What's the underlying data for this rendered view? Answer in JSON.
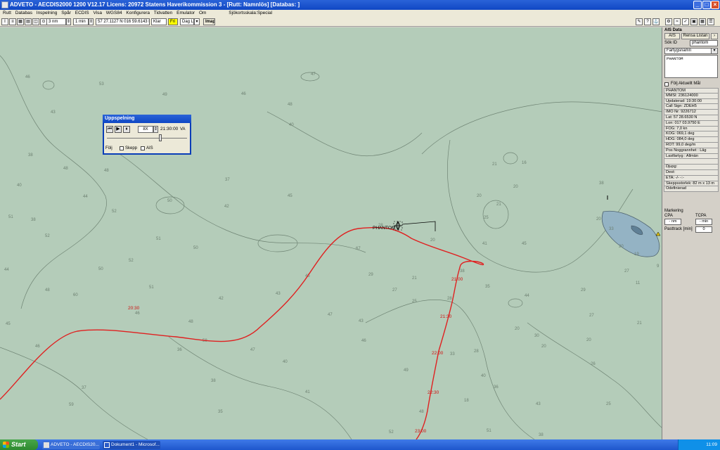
{
  "window": {
    "title": "ADVETO - AECDIS2000 1200 V12.17  Licens: 20972 Statens Haverikommission 3 - [Rutt: Namnlös] [Databas: ]"
  },
  "menu": [
    "Rutt",
    "Databas",
    "Inspelning",
    "Spår",
    "ECDIS",
    "Visa",
    "WGS84",
    "Konfigurera",
    "Tidvatten",
    "Emulator",
    "Om"
  ],
  "menu_scale_label": "Sjökortsskala:Special",
  "toolbar": {
    "range": "3 nm",
    "interval": "1 min",
    "position": "57 27.1127 N  016 59.6143 E",
    "status": "Klar",
    "mode": "Fri",
    "display": "Dag L",
    "imap": "Imap"
  },
  "playback": {
    "title": "Uppspelning",
    "speed": "8X",
    "time": "21:30:00",
    "time_suffix": "VA",
    "follow_label": "Följ",
    "ship_label": "Skepp",
    "ais_label": "AIS"
  },
  "ais_panel": {
    "title": "AIS Data",
    "tab_ais": "AIS",
    "tab_clear": "Rensa Listan",
    "search_label": "Sök ID",
    "search_value": "phantom",
    "filter_value": "Fartygsnamn",
    "list_items": [
      "PHANTOM"
    ],
    "follow_target_label": "Följ Aktuellt Mål",
    "info_rows": [
      "PHANTOM",
      "MMSI: 236124000",
      "Updaterad: 19:30:00",
      "Call Sign: ZDEH5",
      "IMO Nr: 9226712",
      "Lat: 57 28.6530 N",
      "Lon: 017 03.9750 E",
      "FOG: 7,0 kn",
      "KOG: 069,1 deg",
      "HDG: 084,0 deg",
      "ROT: 99,0 deg/m",
      "Pos Noggrannhet : Låg",
      "Lastfartyg : Allmän",
      "",
      "Djupg:",
      "Dest:",
      "ETA: -/- -:-",
      "Skeppsstorlek: 82 m x 13 m",
      "Odefinierad"
    ],
    "marking_label": "Markering",
    "cpa_label": "CPA",
    "tcpa_label": "TCPA",
    "cpa_value": "- nm",
    "tcpa_value": "- min",
    "pasttrack_label": "Pasttrack [min]",
    "pasttrack_value": "0"
  },
  "map": {
    "ship_name": "PHANTOM",
    "time_marks": [
      "20:30",
      "21:00",
      "21:30",
      "22:00",
      "22:30",
      "23:00"
    ],
    "depths": [
      "46",
      "47",
      "53",
      "43",
      "49",
      "48",
      "46",
      "40",
      "43",
      "38",
      "48",
      "48",
      "40",
      "37",
      "44",
      "52",
      "45",
      "42",
      "52",
      "51",
      "50",
      "51",
      "50",
      "50",
      "48",
      "60",
      "44",
      "45",
      "43",
      "42",
      "48",
      "46",
      "47",
      "43",
      "46",
      "49",
      "48",
      "52",
      "41",
      "38",
      "35",
      "58",
      "36",
      "47",
      "40",
      "37",
      "46",
      "59",
      "45",
      "38",
      "52",
      "51",
      "67",
      "28",
      "21",
      "20",
      "20",
      "16",
      "20",
      "25",
      "20",
      "30",
      "35",
      "38",
      "41",
      "45",
      "44",
      "36",
      "20",
      "28",
      "18",
      "20",
      "19",
      "11",
      "9",
      "21",
      "27",
      "26",
      "25",
      "20",
      "29",
      "51",
      "38",
      "43",
      "40",
      "33",
      "27",
      "25",
      "28",
      "29",
      "21",
      "20",
      "21",
      "38",
      "33",
      "27"
    ],
    "track_color": "#e02020"
  },
  "taskbar": {
    "start_label": "Start",
    "tasks": [
      "ADVETO - AECDIS20...",
      "Dokument1 - Microsof..."
    ],
    "clock": "11:09"
  }
}
